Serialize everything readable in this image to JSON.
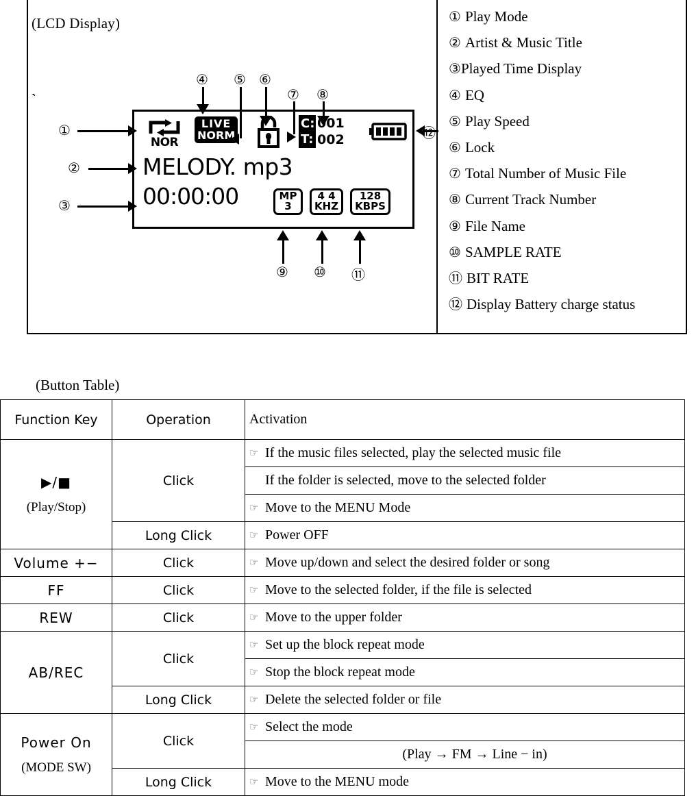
{
  "diagram": {
    "lcd_caption": "(LCD Display)",
    "tick_mark": "`",
    "legend": [
      {
        "num": "①",
        "text": "Play Mode"
      },
      {
        "num": "②",
        "text": "Artist & Music Title"
      },
      {
        "num": "③",
        "text": "Played Time Display",
        "nogap": true
      },
      {
        "num": "④",
        "text": "EQ"
      },
      {
        "num": "⑤",
        "text": "Play Speed"
      },
      {
        "num": "⑥",
        "text": "Lock"
      },
      {
        "num": "⑦",
        "text": "Total Number of Music File"
      },
      {
        "num": "⑧",
        "text": "Current Track Number"
      },
      {
        "num": "⑨",
        "text": "File Name"
      },
      {
        "num": "⑩",
        "text": "SAMPLE RATE"
      },
      {
        "num": "⑪",
        "text": "BIT RATE"
      },
      {
        "num": "⑫",
        "text": "Display Battery charge status"
      }
    ],
    "callout_numbers": {
      "n1": "①",
      "n2": "②",
      "n3": "③",
      "n4": "④",
      "n5": "⑤",
      "n6": "⑥",
      "n7": "⑦",
      "n8": "⑧",
      "n9": "⑨",
      "n10": "⑩",
      "n11": "⑪",
      "n12": "⑫"
    },
    "lcd": {
      "play_mode_label": "NOR",
      "eq_line1": "LIVE",
      "eq_line2": "NORM",
      "current_label": "C:",
      "total_label": "T:",
      "current_value": "001",
      "total_value": "002",
      "battery_bars": 4,
      "file_title": "MELODY. mp3",
      "played_time": "00:00:00",
      "format_badges": [
        {
          "line1": "MP",
          "line2": "3"
        },
        {
          "line1": "4 4",
          "line2": "KHZ"
        },
        {
          "line1": "128",
          "line2": "KBPS"
        }
      ]
    }
  },
  "button_table": {
    "caption": "(Button Table)",
    "headers": [
      "Function Key",
      "Operation",
      "Activation"
    ],
    "hand_icon": "☞",
    "rows": [
      {
        "key_symbol": "▶/■",
        "key_sub": "(Play/Stop)",
        "groups": [
          {
            "operation": "Click",
            "activations": [
              {
                "hand": true,
                "text": "If the music files selected, play the selected music file",
                "center": false
              },
              {
                "hand": false,
                "text": "If the folder is selected, move to the selected folder",
                "center": false
              },
              {
                "hand": true,
                "text": "Move to the MENU Mode",
                "center": false
              }
            ]
          },
          {
            "operation": "Long Click",
            "activations": [
              {
                "hand": true,
                "text": "Power OFF",
                "center": false
              }
            ]
          }
        ]
      },
      {
        "key_symbol": "Volume +−",
        "key_sub": "",
        "groups": [
          {
            "operation": "Click",
            "activations": [
              {
                "hand": true,
                "text": "Move up/down and select the desired folder or song",
                "center": false
              }
            ]
          }
        ]
      },
      {
        "key_symbol": "FF",
        "key_sub": "",
        "groups": [
          {
            "operation": "Click",
            "activations": [
              {
                "hand": true,
                "text": "Move to the selected folder, if the file is selected",
                "center": false
              }
            ]
          }
        ]
      },
      {
        "key_symbol": "REW",
        "key_sub": "",
        "groups": [
          {
            "operation": "Click",
            "activations": [
              {
                "hand": true,
                "text": "Move to the upper folder",
                "center": false
              }
            ]
          }
        ]
      },
      {
        "key_symbol": "AB/REC",
        "key_sub": "",
        "groups": [
          {
            "operation": "Click",
            "activations": [
              {
                "hand": true,
                "text": "Set up the block repeat mode",
                "center": false
              },
              {
                "hand": true,
                "text": "Stop the block repeat mode",
                "center": false
              }
            ]
          },
          {
            "operation": "Long Click",
            "activations": [
              {
                "hand": true,
                "text": "Delete the selected folder or file",
                "center": false
              }
            ]
          }
        ]
      },
      {
        "key_symbol": "Power On",
        "key_sub": "(MODE SW)",
        "groups": [
          {
            "operation": "Click",
            "activations": [
              {
                "hand": true,
                "text": "Select the mode",
                "center": false
              },
              {
                "hand": false,
                "text": "(Play → FM → Line − in)",
                "center": true
              }
            ]
          },
          {
            "operation": "Long Click",
            "activations": [
              {
                "hand": true,
                "text": "Move to the MENU mode",
                "center": false
              }
            ]
          }
        ]
      }
    ]
  }
}
